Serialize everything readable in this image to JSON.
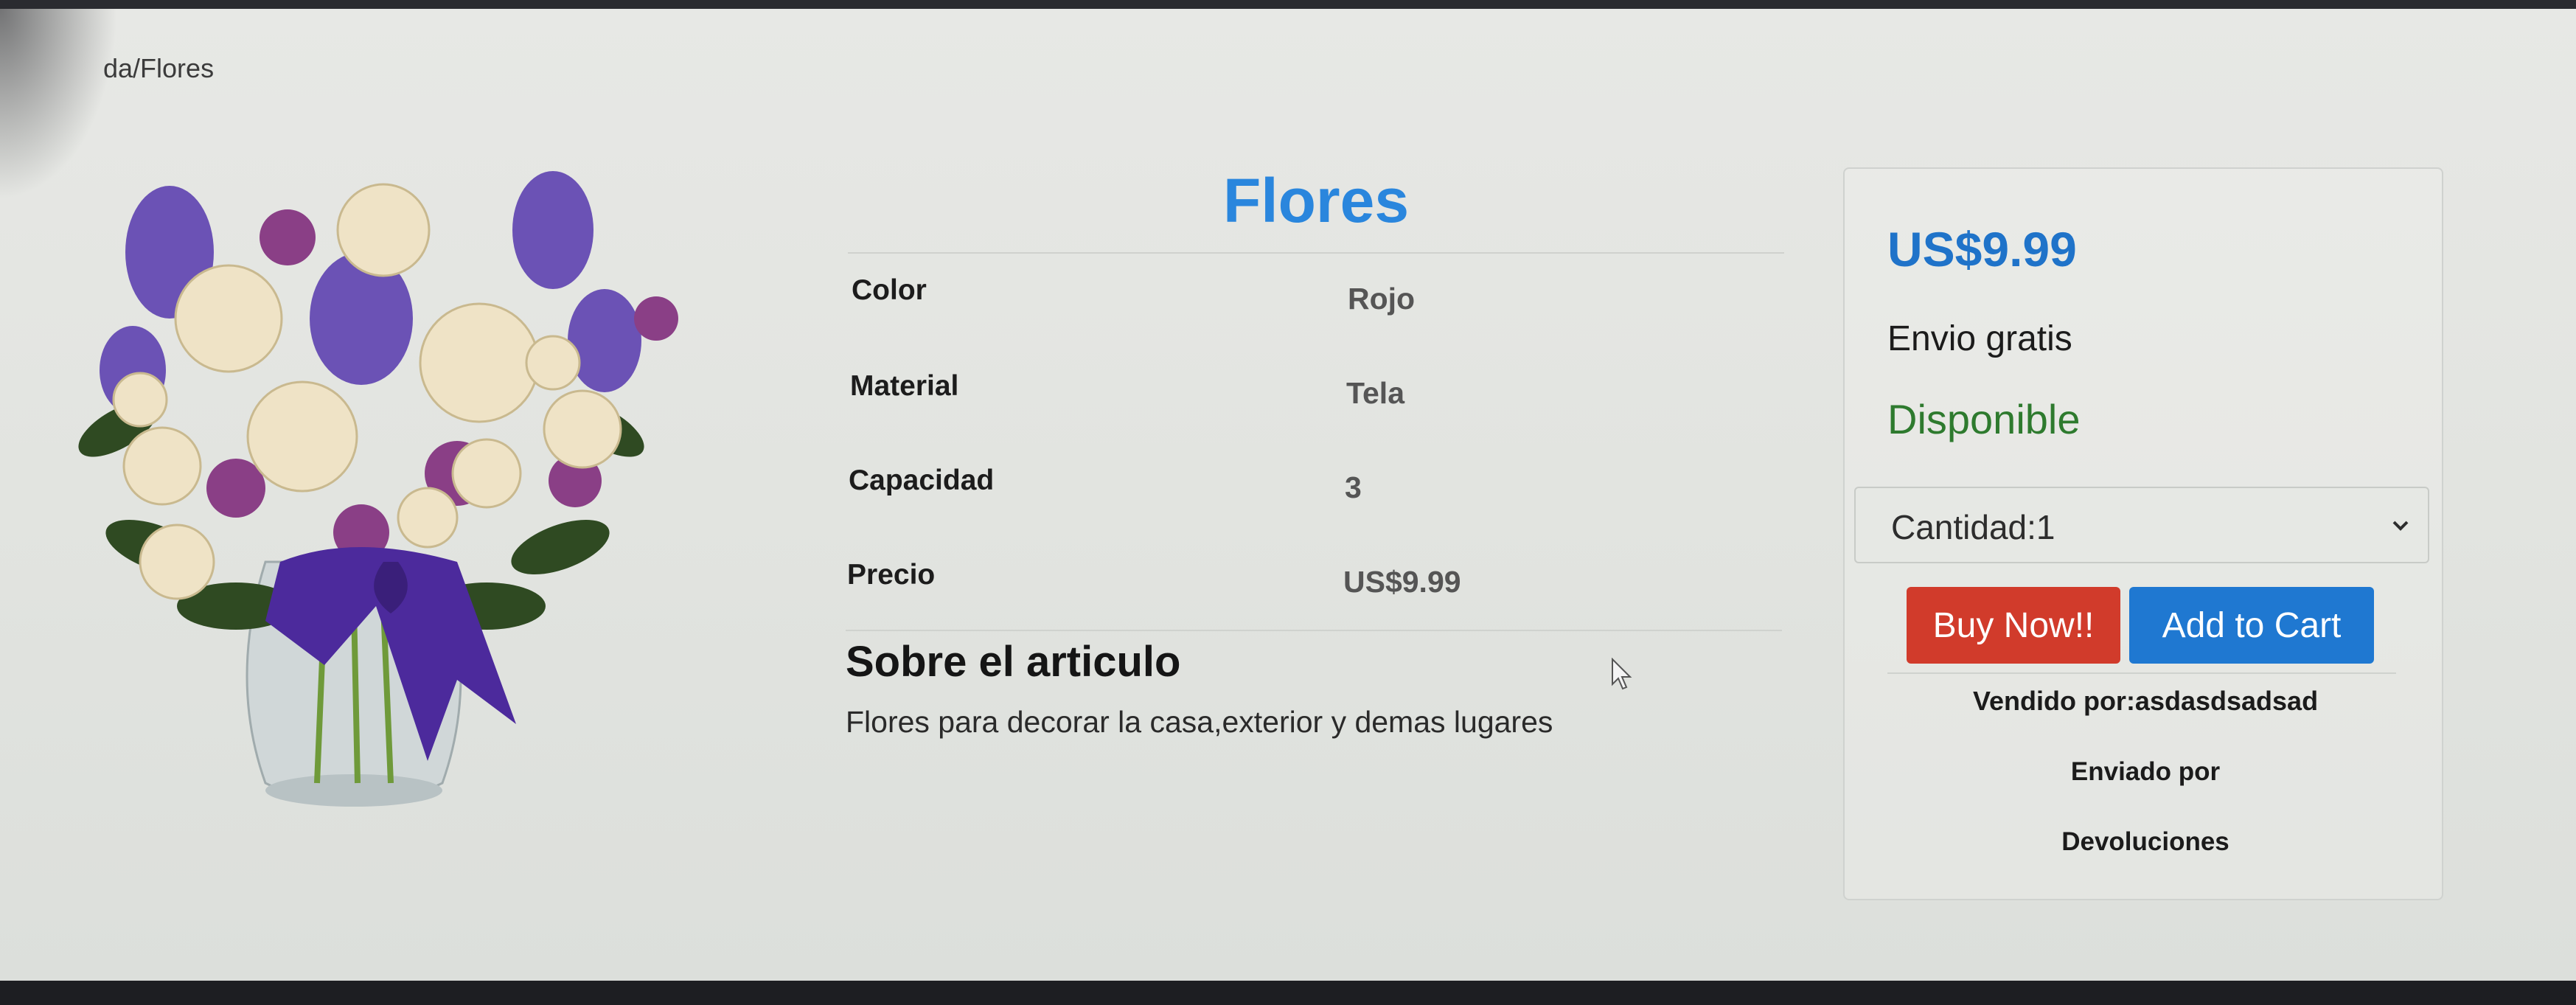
{
  "breadcrumb": {
    "text": "da/Flores"
  },
  "product": {
    "title": "Flores",
    "image_icon": "flower-bouquet-image",
    "specs": [
      {
        "label": "Color",
        "value": "Rojo"
      },
      {
        "label": "Material",
        "value": "Tela"
      },
      {
        "label": "Capacidad",
        "value": "3"
      },
      {
        "label": "Precio",
        "value": "US$9.99"
      }
    ],
    "about_heading": "Sobre el articulo",
    "about_text": "Flores para decorar la casa,exterior y demas lugares"
  },
  "buybox": {
    "price": "US$9.99",
    "shipping": "Envio gratis",
    "stock": "Disponible",
    "quantity_label": "Cantidad:1",
    "buy_now_label": "Buy Now!!",
    "add_to_cart_label": "Add to Cart",
    "sold_by": "Vendido por:asdasdsadsad",
    "shipped_by": "Enviado por",
    "returns": "Devoluciones"
  },
  "colors": {
    "title": "#2a86dd",
    "price": "#1f73c9",
    "stock": "#2e7a2e",
    "buy_now": "#d13b2b",
    "add_to_cart": "#1f78d1"
  }
}
